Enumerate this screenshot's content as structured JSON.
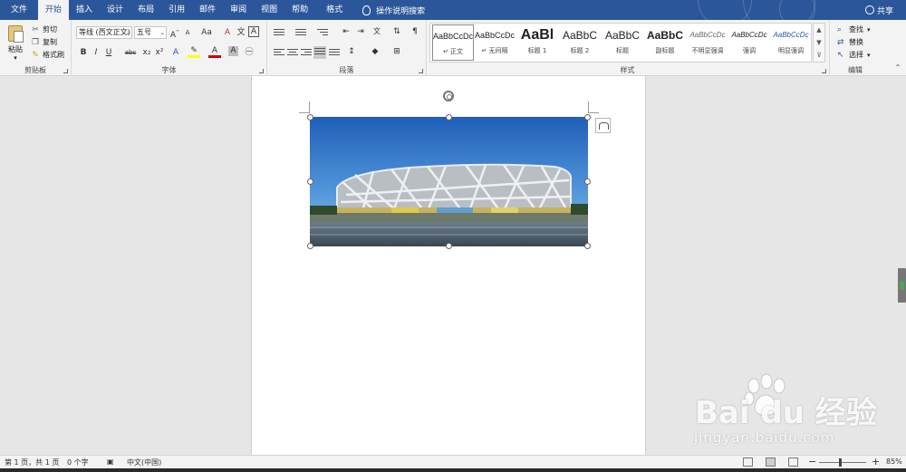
{
  "menu": {
    "tabs": [
      "文件",
      "开始",
      "插入",
      "设计",
      "布局",
      "引用",
      "邮件",
      "审阅",
      "视图",
      "帮助",
      "格式"
    ],
    "active_tab": "开始",
    "tell_me": "操作说明搜索",
    "share": "共享"
  },
  "clipboard": {
    "paste": "粘贴",
    "cut": "剪切",
    "copy": "复制",
    "format_painter": "格式刷",
    "group": "剪贴板"
  },
  "font": {
    "name": "等线 (西文正文)",
    "size": "五号",
    "grow": "A",
    "shrink": "A",
    "case": "Aa",
    "bold": "B",
    "italic": "I",
    "underline": "U",
    "strike": "abc",
    "subscript": "x₂",
    "superscript": "x²",
    "group": "字体"
  },
  "paragraph": {
    "group": "段落"
  },
  "styles": {
    "items": [
      {
        "preview": "AaBbCcDc",
        "name": "↵ 正文"
      },
      {
        "preview": "AaBbCcDc",
        "name": "↵ 无间隔"
      },
      {
        "preview": "AaBl",
        "name": "标题 1"
      },
      {
        "preview": "AaBbC",
        "name": "标题 2"
      },
      {
        "preview": "AaBbC",
        "name": "标题"
      },
      {
        "preview": "AaBbC",
        "name": "副标题"
      },
      {
        "preview": "AaBbCcDc",
        "name": "不明显强调"
      },
      {
        "preview": "AaBbCcDc",
        "name": "强调"
      },
      {
        "preview": "AaBbCcDc",
        "name": "明显强调"
      }
    ],
    "group": "样式"
  },
  "editing": {
    "find": "查找",
    "replace": "替换",
    "select": "选择",
    "group": "编辑"
  },
  "status": {
    "page": "第 1 页，共 1 页",
    "words": "0 个字",
    "language": "中文(中国)",
    "zoom": "85%",
    "zoom_minus": "−",
    "zoom_plus": "+"
  },
  "watermark": {
    "logo": "Bai du 经验",
    "url": "jingyan.baidu.com"
  },
  "colors": {
    "accent": "#2b579a",
    "font_color": "#d00000",
    "highlight": "#ffff00"
  }
}
